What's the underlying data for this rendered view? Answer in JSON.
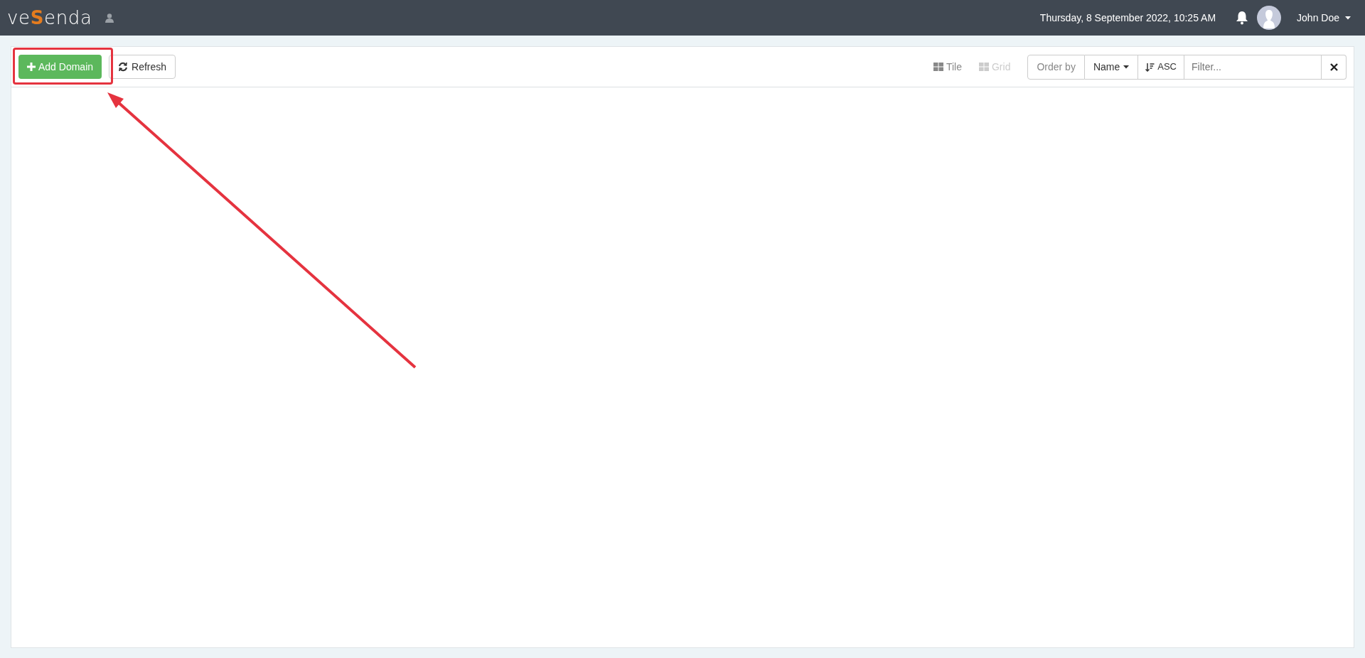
{
  "header": {
    "logo": [
      {
        "text": "ve",
        "accent": false
      },
      {
        "text": "S",
        "accent": true
      },
      {
        "text": "enda",
        "accent": false
      }
    ],
    "datetime": "Thursday, 8 September 2022, 10:25 AM",
    "user": "John Doe"
  },
  "toolbar": {
    "add_button": "Add Domain",
    "refresh_button": "Refresh",
    "views": [
      {
        "label": "Tile",
        "selected": true
      },
      {
        "label": "Grid",
        "selected": false
      }
    ],
    "order_by": "Order by",
    "sort_field": "Name",
    "sort_direction": "ASC",
    "filter": {
      "placeholder": "Filter..."
    }
  },
  "annotation": {
    "highlight": true,
    "arrow": true
  }
}
